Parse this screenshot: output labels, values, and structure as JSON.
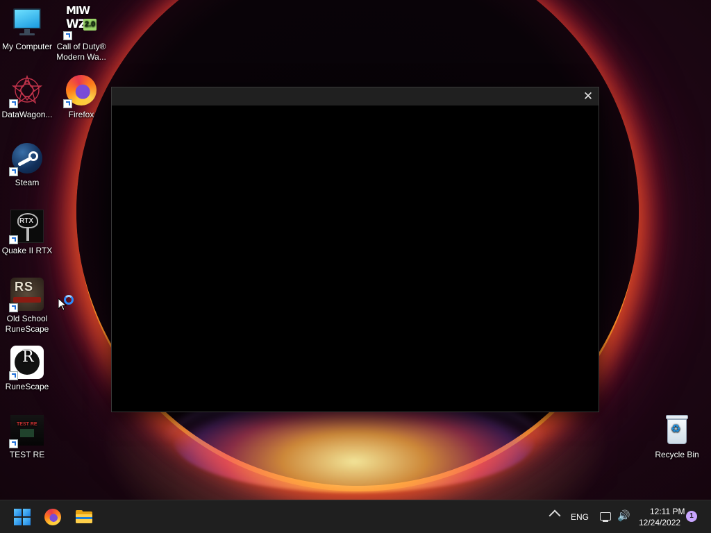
{
  "desktop": {
    "icons": [
      {
        "label": "My Computer",
        "icon": "my-computer-icon"
      },
      {
        "label": "Call of Duty® Modern Wa...",
        "icon": "call-of-duty-icon",
        "tile_top": "MIW",
        "tile_bottom": "WZ",
        "tile_badge": "2.0"
      },
      {
        "label": "DataWagon...",
        "icon": "datawagon-icon"
      },
      {
        "label": "Firefox",
        "icon": "firefox-icon"
      },
      {
        "label": "Steam",
        "icon": "steam-icon"
      },
      {
        "label": "Quake II RTX",
        "icon": "quake-rtx-icon",
        "tile_text": "RTX"
      },
      {
        "label": "Old School RuneScape",
        "icon": "old-school-runescape-icon",
        "tile_text": "RS"
      },
      {
        "label": "RuneScape",
        "icon": "runescape-icon",
        "tile_text": "R"
      },
      {
        "label": "TEST RE",
        "icon": "test-re-icon",
        "tile_text": "TEST RE"
      },
      {
        "label": "Recycle Bin",
        "icon": "recycle-bin-icon"
      }
    ]
  },
  "window": {
    "close_glyph": "✕"
  },
  "taskbar": {
    "pinned": [
      "start-icon",
      "firefox-icon",
      "file-explorer-icon"
    ],
    "tray": {
      "language": "ENG",
      "time": "12:11 PM",
      "date": "12/24/2022",
      "notifications": "1"
    }
  },
  "colors": {
    "taskbar_bg": "#1f1f1f",
    "window_bg": "#000000",
    "titlebar_bg": "#202020",
    "accent": "#1c7fe0"
  }
}
